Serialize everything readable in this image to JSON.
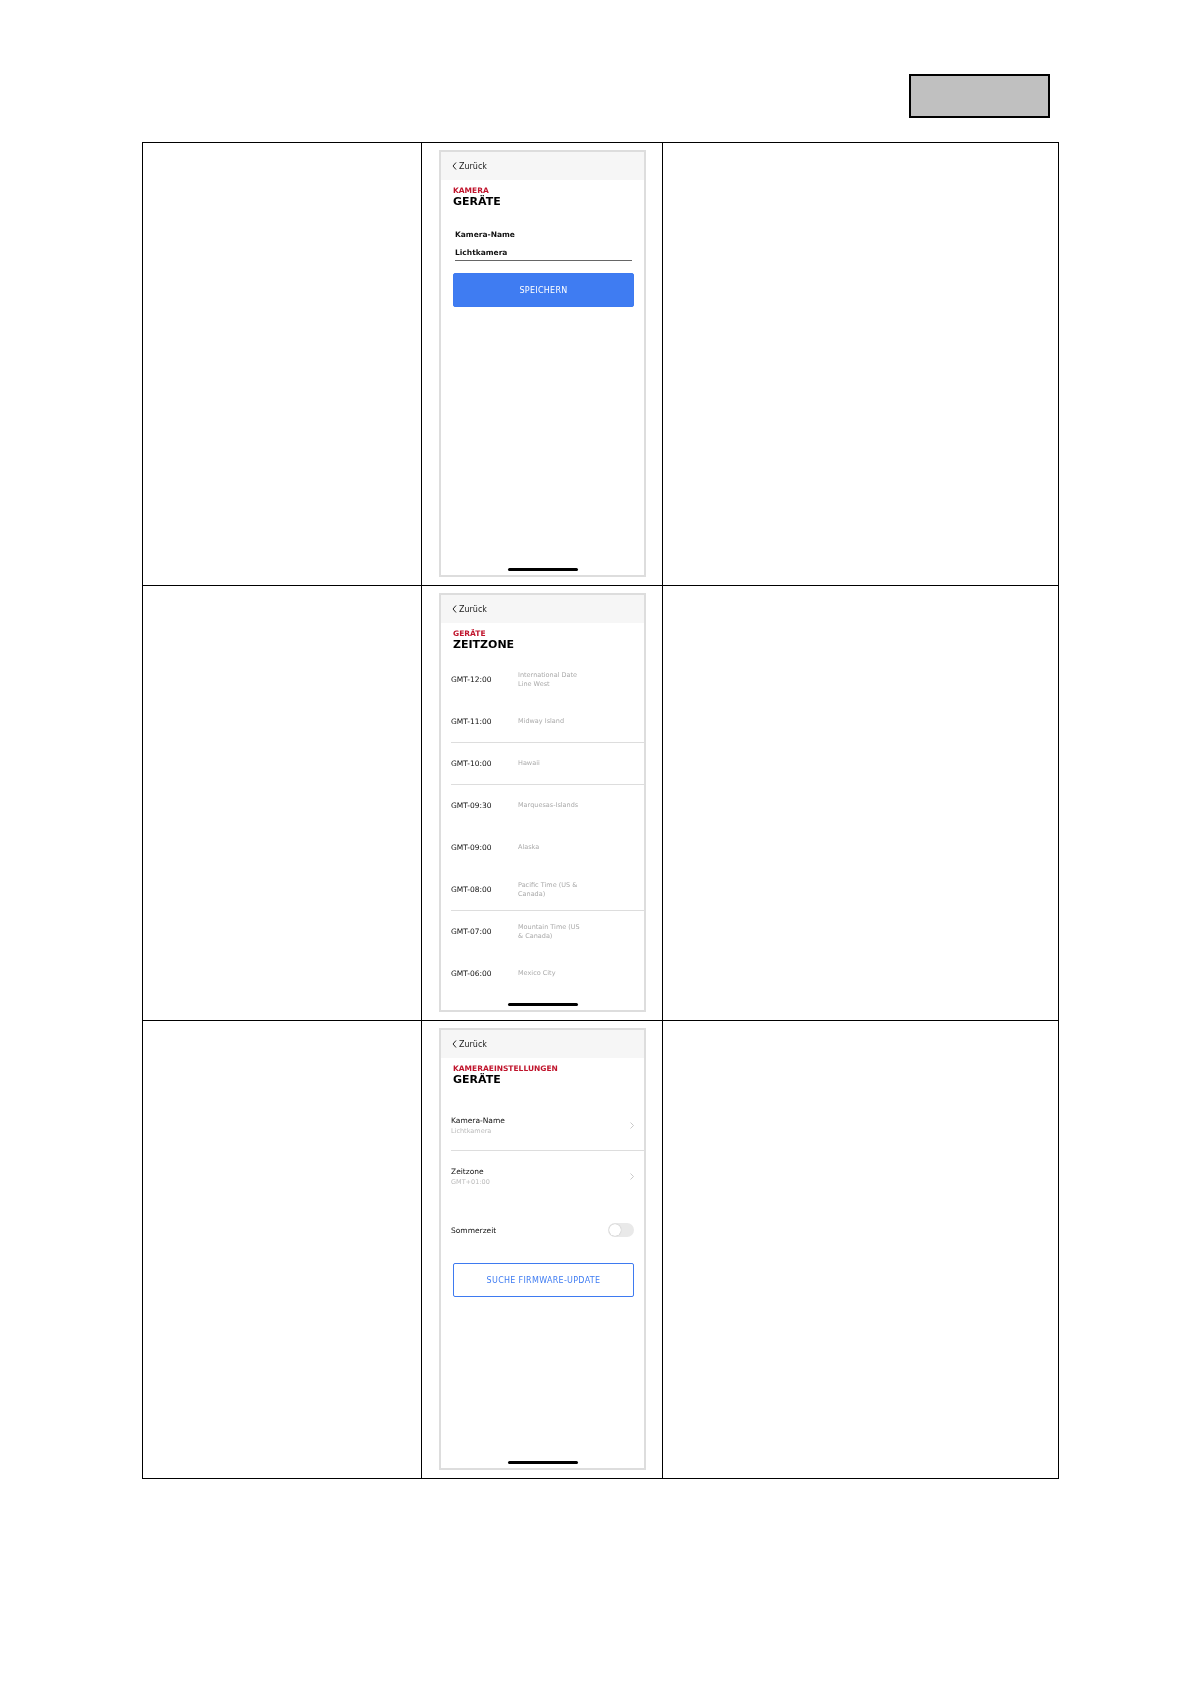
{
  "table": {
    "rows": [
      {
        "screen": {
          "kind": "name_edit",
          "back": "Zurück",
          "kicker": "KAMERA",
          "title": "GERÄTE",
          "field_label": "Kamera-Name",
          "field_value": "Lichtkamera",
          "button": "SPEICHERN"
        }
      },
      {
        "screen": {
          "kind": "timezone_list",
          "back": "Zurück",
          "kicker": "GERÄTE",
          "title": "ZEITZONE",
          "zones": [
            {
              "offset": "GMT-12:00",
              "name": "International Date Line West",
              "divider": false
            },
            {
              "offset": "GMT-11:00",
              "name": "Midway Island",
              "divider": true
            },
            {
              "offset": "GMT-10:00",
              "name": "Hawaii",
              "divider": true
            },
            {
              "offset": "GMT-09:30",
              "name": "Marquesas-Islands",
              "divider": false
            },
            {
              "offset": "GMT-09:00",
              "name": "Alaska",
              "divider": false
            },
            {
              "offset": "GMT-08:00",
              "name": "Pacific Time (US & Canada)",
              "divider": true
            },
            {
              "offset": "GMT-07:00",
              "name": "Mountain Time (US & Canada)",
              "divider": false
            },
            {
              "offset": "GMT-06:00",
              "name": "Mexico City",
              "divider": false
            }
          ]
        }
      },
      {
        "screen": {
          "kind": "settings",
          "back": "Zurück",
          "kicker": "KAMERAEINSTELLUNGEN",
          "title": "GERÄTE",
          "items": [
            {
              "kind": "link",
              "label": "Kamera-Name",
              "value": "Lichtkamera",
              "divider": true
            },
            {
              "kind": "link",
              "label": "Zeitzone",
              "value": "GMT+01:00",
              "divider": false
            },
            {
              "kind": "toggle",
              "label": "Sommerzeit",
              "on": false,
              "divider": false
            }
          ],
          "button": "SUCHE FIRMWARE-UPDATE"
        }
      }
    ]
  }
}
